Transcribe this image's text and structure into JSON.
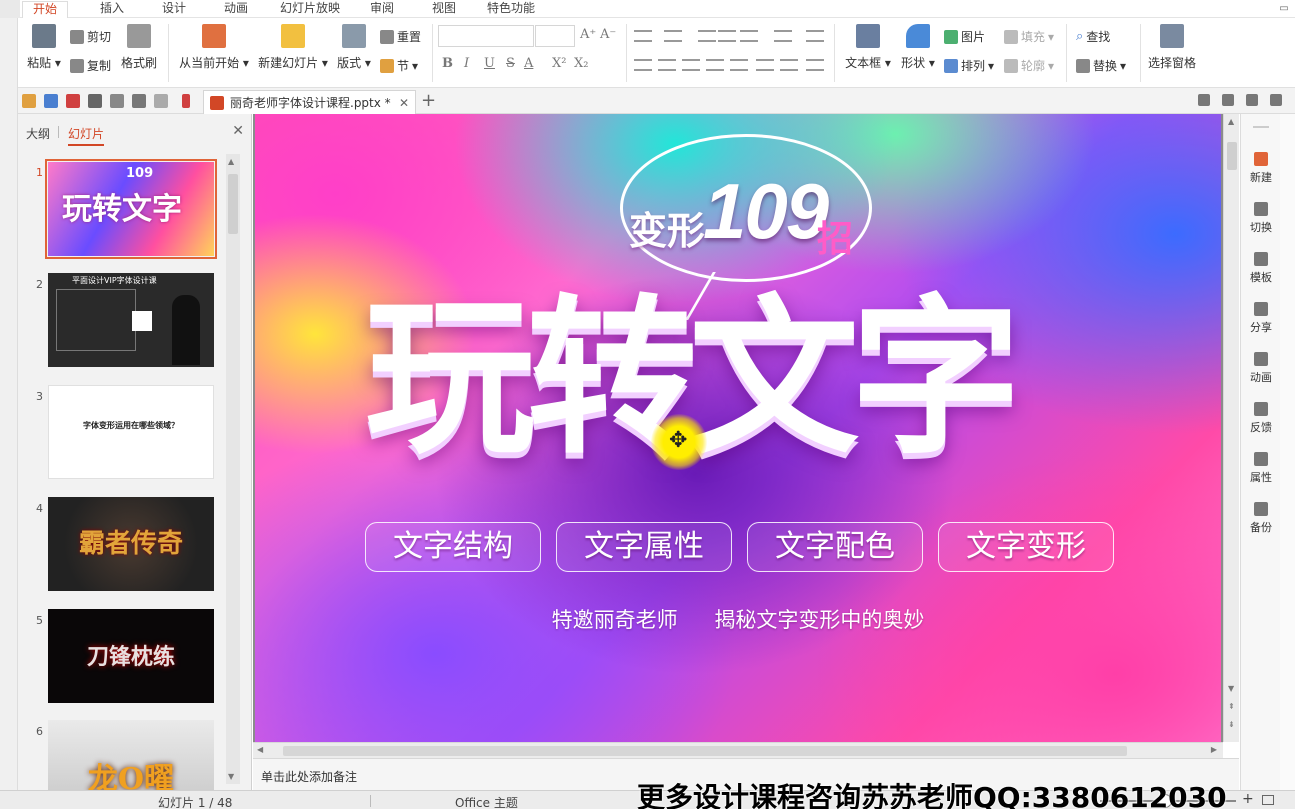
{
  "menu": {
    "tabs": [
      {
        "label": "开始",
        "active": true
      },
      {
        "label": "插入"
      },
      {
        "label": "设计"
      },
      {
        "label": "动画"
      },
      {
        "label": "幻灯片放映"
      },
      {
        "label": "审阅"
      },
      {
        "label": "视图"
      },
      {
        "label": "特色功能"
      }
    ]
  },
  "ribbon": {
    "paste": "粘贴",
    "cut": "剪切",
    "copy": "复制",
    "format_painter": "格式刷",
    "start_from_current": "从当前开始",
    "new_slide": "新建幻灯片",
    "layout": "版式",
    "reset": "重置",
    "section": "节",
    "font_buttons": [
      "B",
      "I",
      "U",
      "S",
      "A",
      "X²",
      "X₂"
    ],
    "textbox": "文本框",
    "shape": "形状",
    "picture": "图片",
    "arrange": "排列",
    "fill": "填充",
    "outline": "轮廓",
    "find": "查找",
    "replace": "替换",
    "selection_pane": "选择窗格"
  },
  "document": {
    "tab_title": "丽奇老师字体设计课程.pptx *",
    "close": "✕",
    "new_tab": "+"
  },
  "left_panel": {
    "tab_outline": "大纲",
    "tab_slides": "幻灯片",
    "close": "✕",
    "thumbnails": [
      {
        "num": "1",
        "title": "玩转文字",
        "badge": "109",
        "selected": true
      },
      {
        "num": "2",
        "title": "平面设计VIP字体设计课"
      },
      {
        "num": "3",
        "title": "字体变形运用在哪些领域？"
      },
      {
        "num": "4",
        "title": "霸者传奇"
      },
      {
        "num": "5",
        "title": "刀锋枕练"
      },
      {
        "num": "6",
        "title": "龙O曜"
      }
    ]
  },
  "slide": {
    "bubble_prefix": "变形",
    "bubble_number": "109",
    "bubble_suffix": "招",
    "main_title": "玩转文字",
    "tags": [
      "文字结构",
      "文字属性",
      "文字配色",
      "文字变形"
    ],
    "subtitle_left": "特邀丽奇老师",
    "subtitle_right": "揭秘文字变形中的奥妙"
  },
  "notes": {
    "placeholder": "单击此处添加备注"
  },
  "right_pane": [
    {
      "label": "新建",
      "icon": "new-doc-icon"
    },
    {
      "label": "切换",
      "icon": "switch-icon"
    },
    {
      "label": "模板",
      "icon": "template-icon"
    },
    {
      "label": "分享",
      "icon": "share-icon"
    },
    {
      "label": "动画",
      "icon": "animation-icon"
    },
    {
      "label": "反馈",
      "icon": "feedback-icon"
    },
    {
      "label": "属性",
      "icon": "properties-icon"
    },
    {
      "label": "备份",
      "icon": "backup-icon"
    }
  ],
  "status": {
    "slide_counter": "幻灯片 1 / 48",
    "theme": "Office 主题",
    "zoom_plus": "+"
  },
  "watermark": "更多设计课程咨询苏苏老师QQ:3380612030",
  "colors": {
    "accent": "#d24726",
    "selection": "#e06438"
  }
}
